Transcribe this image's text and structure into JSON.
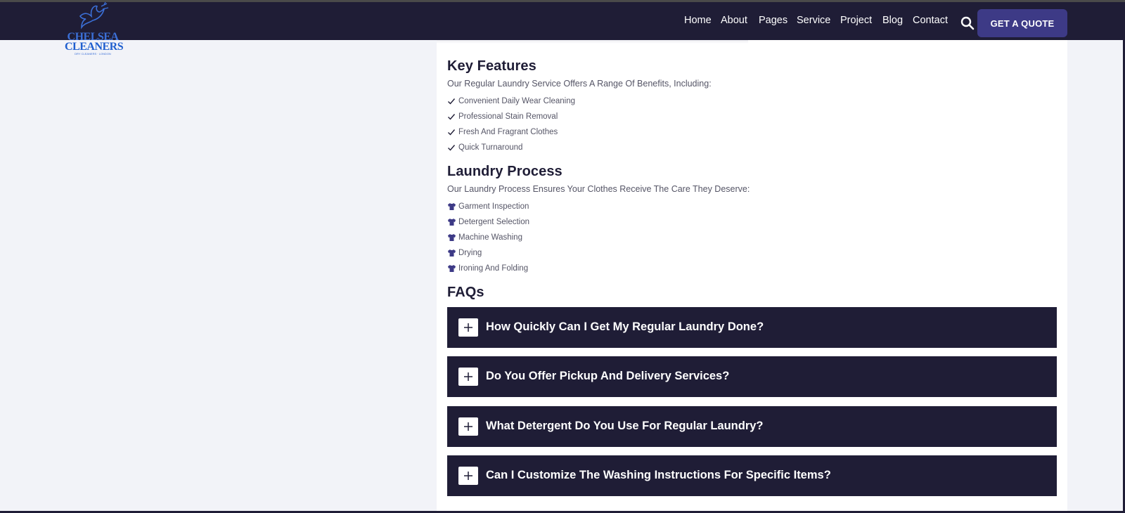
{
  "brand": {
    "logo_line1": "CHELSEA",
    "logo_line2": "CLEANERS",
    "logo_tagline": "DRY CLEANERS · LONDON"
  },
  "nav": {
    "items": [
      "Home",
      "About",
      "Pages",
      "Service",
      "Project",
      "Blog",
      "Contact"
    ],
    "cta_label": "GET A QUOTE",
    "icons": {
      "search": "search-icon"
    }
  },
  "key_features": {
    "heading": "Key Features",
    "intro": "Our Regular Laundry Service Offers A Range Of Benefits, Including:",
    "items": [
      "Convenient Daily Wear Cleaning",
      "Professional Stain Removal",
      "Fresh And Fragrant Clothes",
      "Quick Turnaround"
    ],
    "item_icon": "check-icon"
  },
  "laundry_process": {
    "heading": "Laundry Process",
    "intro": "Our Laundry Process Ensures Your Clothes Receive The Care They Deserve:",
    "items": [
      "Garment Inspection",
      "Detergent Selection",
      "Machine Washing",
      "Drying",
      "Ironing And Folding"
    ],
    "item_icon": "tshirt-icon"
  },
  "faqs": {
    "heading": "FAQs",
    "items": [
      "How Quickly Can I Get My Regular Laundry Done?",
      "Do You Offer Pickup And Delivery Services?",
      "What Detergent Do You Use For Regular Laundry?",
      "Can I Customize The Washing Instructions For Specific Items?"
    ],
    "toggle_icon": "plus-icon"
  },
  "colors": {
    "header_bg": "#1f1d36",
    "accent": "#3d3a86",
    "page_bg": "#f2f3f8",
    "text_dark": "#1f1d36",
    "text_muted": "#555566",
    "logo_blue": "#3b6fd6"
  }
}
